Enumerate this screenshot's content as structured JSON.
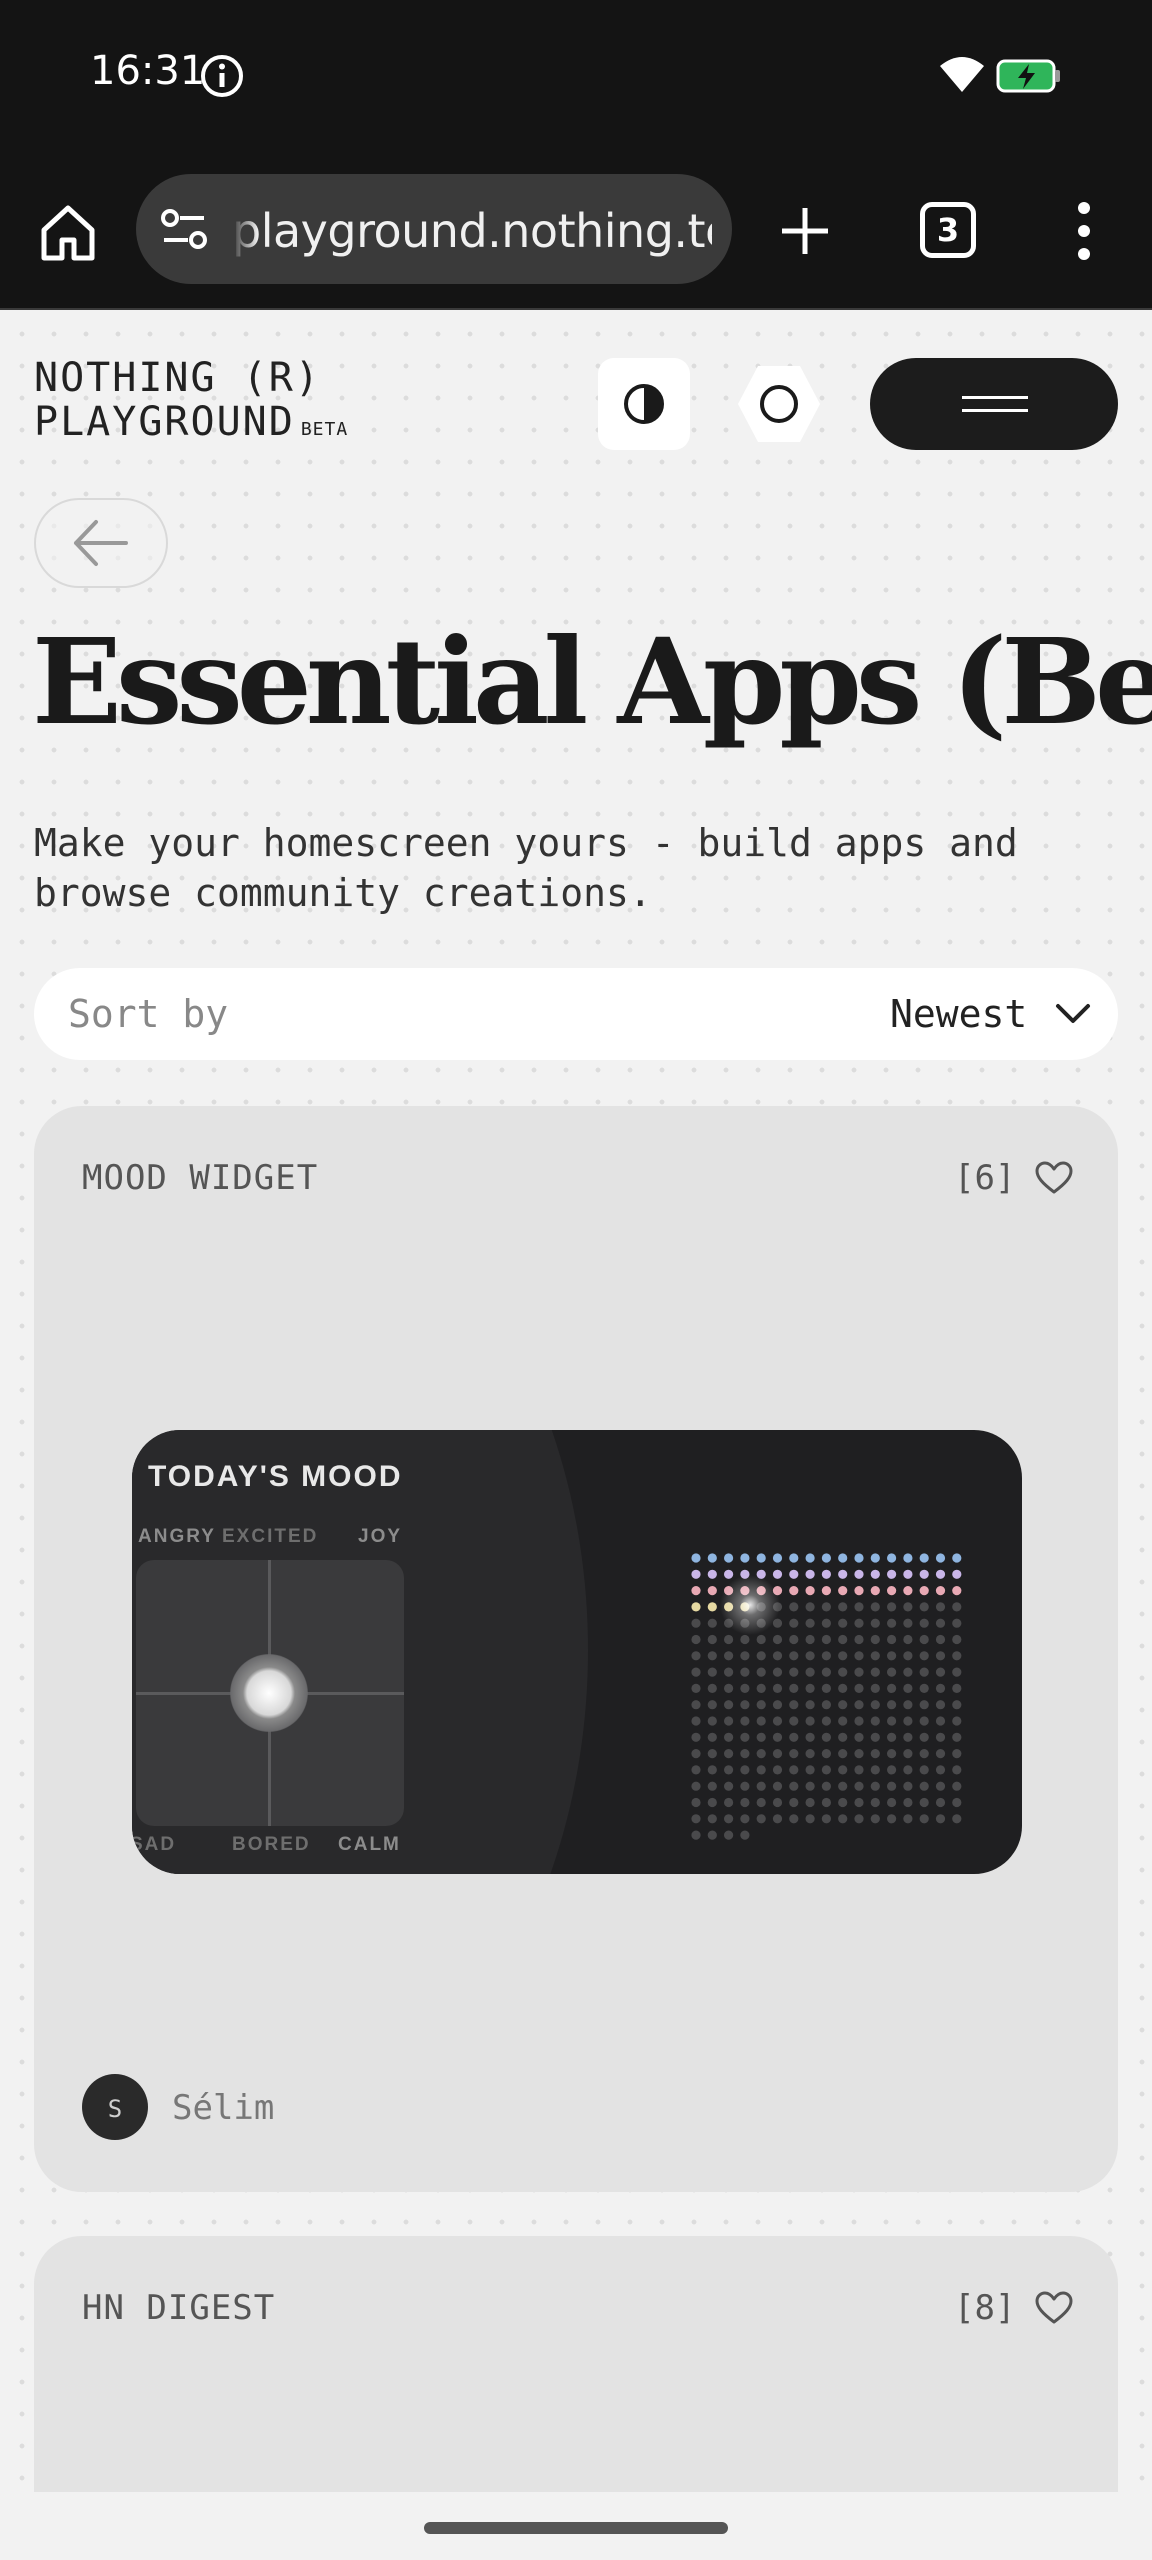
{
  "status_bar": {
    "time": "16:31",
    "icons": [
      "info-icon",
      "wifi-icon",
      "battery-charging-icon"
    ],
    "battery_color": "#2fb55a"
  },
  "browser": {
    "url": "playground.nothing.tech",
    "tab_count": "3",
    "icons": [
      "home-icon",
      "site-settings-icon",
      "plus-icon",
      "more-vert-icon"
    ]
  },
  "header": {
    "logo_line1": "NOTHING (R)",
    "logo_line2": "PLAYGROUND",
    "logo_badge": "BETA",
    "icons": [
      "contrast-icon",
      "circle-icon",
      "hamburger-icon"
    ]
  },
  "page": {
    "title": "Essential Apps (Beta)",
    "subtitle": "Make your homescreen yours - build apps and browse community creations."
  },
  "sort": {
    "label": "Sort by",
    "value": "Newest"
  },
  "cards": [
    {
      "title": "MOOD WIDGET",
      "likes": "[6]",
      "author": "Sélim",
      "author_initial": "S",
      "widget": {
        "title": "TODAY'S MOOD",
        "labels_top": [
          "ANGRY",
          "EXCITED",
          "JOY"
        ],
        "labels_bottom": [
          "SAD",
          "BORED",
          "CALM"
        ]
      }
    },
    {
      "title": "HN DIGEST",
      "likes": "[8]"
    }
  ],
  "colors": {
    "page_bg": "#f2f2f2",
    "card_bg": "#e3e3e3",
    "widget_bg": "#1f1f21",
    "dark_button": "#1c1c1c",
    "mood_dot_colors": [
      "#8fb5e0",
      "#c9b6e8",
      "#e8a9b4",
      "#e6d9a2"
    ]
  }
}
